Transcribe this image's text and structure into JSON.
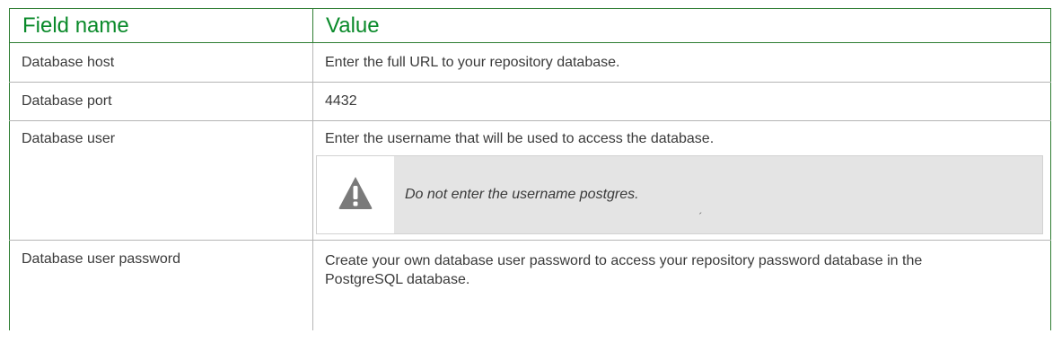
{
  "table": {
    "headers": {
      "field_name": "Field name",
      "value": "Value"
    },
    "rows": [
      {
        "field": "Database host",
        "value": "Enter the full URL to your repository database."
      },
      {
        "field": "Database port",
        "value": "4432"
      },
      {
        "field": "Database user",
        "value": "Enter the username that will be used to access the database.",
        "notice": {
          "icon": "warning-icon",
          "text": "Do not enter the username postgres.",
          "mark": "´"
        }
      },
      {
        "field": "Database user password",
        "value": "Create your own database user password to access your repository password database in the PostgreSQL database."
      }
    ]
  },
  "colors": {
    "header_text": "#0a8a2a",
    "outer_border": "#2e7d32",
    "notice_background": "#e4e4e4",
    "icon_gray": "#7a7a7a"
  }
}
